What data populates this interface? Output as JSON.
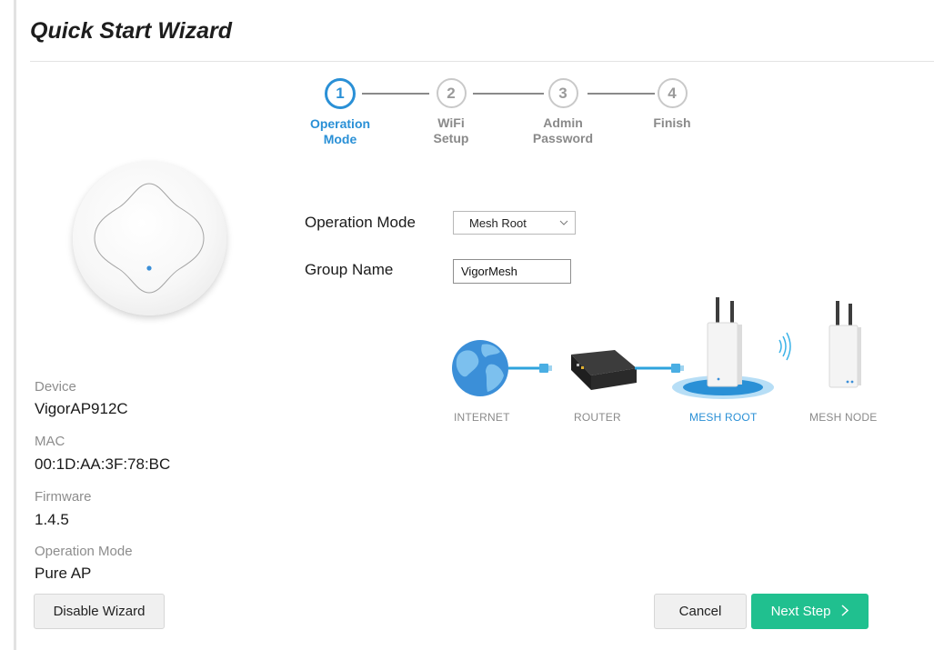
{
  "page": {
    "title": "Quick Start Wizard"
  },
  "stepper": {
    "current_step": 1,
    "steps": [
      {
        "number": "1",
        "label_line1": "Operation",
        "label_line2": "Mode",
        "active": true
      },
      {
        "number": "2",
        "label_line1": "WiFi",
        "label_line2": "Setup",
        "active": false
      },
      {
        "number": "3",
        "label_line1": "Admin",
        "label_line2": "Password",
        "active": false
      },
      {
        "number": "4",
        "label_line1": "Finish",
        "label_line2": "",
        "active": false
      }
    ]
  },
  "device_info": {
    "device_label": "Device",
    "device_value": "VigorAP912C",
    "mac_label": "MAC",
    "mac_value": "00:1D:AA:3F:78:BC",
    "firmware_label": "Firmware",
    "firmware_value": "1.4.5",
    "op_mode_label": "Operation Mode",
    "op_mode_value": "Pure AP"
  },
  "form": {
    "operation_mode_label": "Operation Mode",
    "operation_mode_value": "Mesh Root",
    "group_name_label": "Group Name",
    "group_name_value": "VigorMesh"
  },
  "topology": {
    "internet_label": "INTERNET",
    "router_label": "ROUTER",
    "mesh_root_label": "MESH ROOT",
    "mesh_node_label": "MESH NODE",
    "active_color": "#2a90d6"
  },
  "buttons": {
    "disable_wizard": "Disable Wizard",
    "cancel": "Cancel",
    "next_step": "Next Step",
    "next_step_icon": "chevron-right-icon"
  },
  "colors": {
    "accent": "#2a90d6",
    "primary_button": "#20c08f"
  }
}
